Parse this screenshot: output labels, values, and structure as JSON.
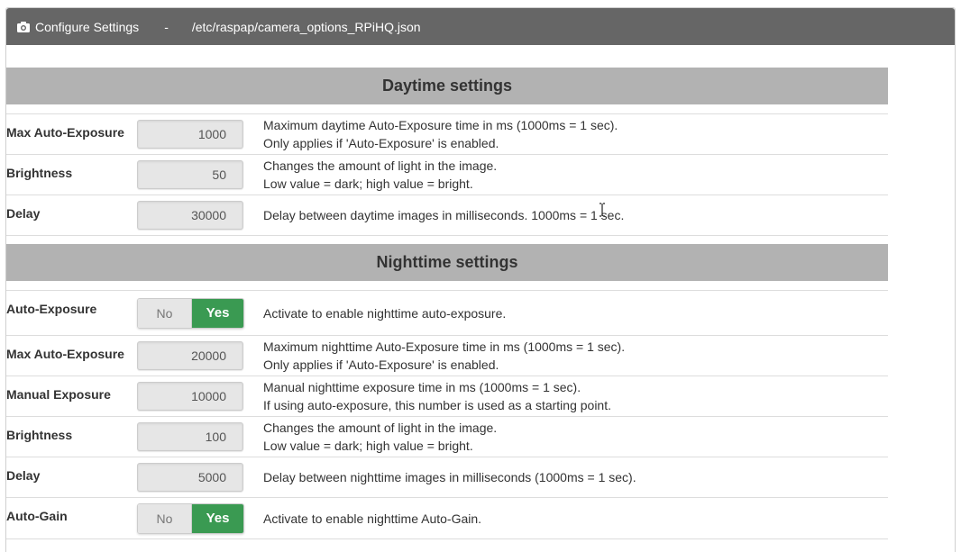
{
  "header": {
    "title": "Configure Settings",
    "separator": "-",
    "path": "/etc/raspap/camera_options_RPiHQ.json",
    "icon": "camera-icon"
  },
  "daytime": {
    "heading": "Daytime settings",
    "rows": [
      {
        "label": "Max Auto-Exposure",
        "value": "1000",
        "desc1": "Maximum daytime Auto-Exposure time in ms (1000ms = 1 sec).",
        "desc2": "Only applies if 'Auto-Exposure' is enabled."
      },
      {
        "label": "Brightness",
        "value": "50",
        "desc1": "Changes the amount of light in the image.",
        "desc2": "Low value = dark; high value = bright."
      },
      {
        "label": "Delay",
        "value": "30000",
        "desc1": "Delay between daytime images in milliseconds. 1000ms = 1 sec."
      }
    ]
  },
  "nighttime": {
    "heading": "Nighttime settings",
    "auto_exposure": {
      "label": "Auto-Exposure",
      "no": "No",
      "yes": "Yes",
      "desc1": "Activate to enable nighttime auto-exposure."
    },
    "rows": [
      {
        "label": "Max Auto-Exposure",
        "value": "20000",
        "desc1": "Maximum nighttime Auto-Exposure time in ms (1000ms = 1 sec).",
        "desc2": "Only applies if 'Auto-Exposure' is enabled."
      },
      {
        "label": "Manual Exposure",
        "value": "10000",
        "desc1": "Manual nighttime exposure time in ms (1000ms = 1 sec).",
        "desc2": "If using auto-exposure, this number is used as a starting point."
      },
      {
        "label": "Brightness",
        "value": "100",
        "desc1": "Changes the amount of light in the image.",
        "desc2": "Low value = dark; high value = bright."
      },
      {
        "label": "Delay",
        "value": "5000",
        "desc1": "Delay between nighttime images in milliseconds (1000ms = 1 sec)."
      }
    ],
    "auto_gain": {
      "label": "Auto-Gain",
      "no": "No",
      "yes": "Yes",
      "desc1": "Activate to enable nighttime Auto-Gain."
    }
  },
  "colors": {
    "header_bg": "#666666",
    "section_bg": "#b2b2b2",
    "toggle_yes": "#3a9a52"
  }
}
